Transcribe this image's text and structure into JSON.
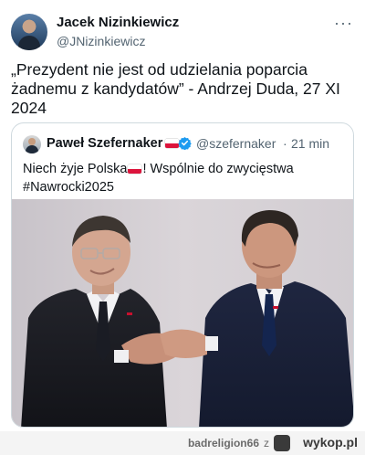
{
  "tweet": {
    "display_name": "Jacek Nizinkiewicz",
    "handle": "@JNizinkiewicz",
    "more_icon": "ellipsis-icon",
    "text": "„Prezydent nie jest od udzielania poparcia żadnemu z kandydatów” - Andrzej Duda, 27 XI 2024"
  },
  "quote": {
    "display_name": "Paweł Szefernaker",
    "handle": "@szefernaker",
    "separator": "·",
    "time": "21 min",
    "verified_icon": "verified-badge-icon",
    "flag_icon": "poland-flag-icon",
    "text_part1": "Niech żyje Polska",
    "text_part2": "! Wspólnie do zwycięstwa",
    "hashtag": "#Nawrocki2025"
  },
  "footer": {
    "username": "badreligion66",
    "separator": "z",
    "site": "wykop.pl",
    "logo_icon": "wykop-logo-icon"
  },
  "colors": {
    "text": "#0f1419",
    "muted": "#536471",
    "verified": "#1d9bf0",
    "border": "#cfd9de"
  }
}
